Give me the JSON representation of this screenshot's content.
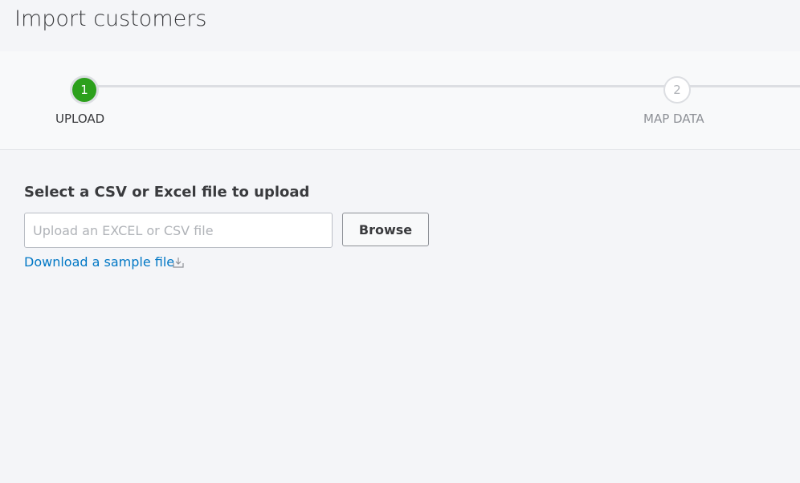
{
  "page": {
    "title": "Import customers"
  },
  "steps": [
    {
      "number": "1",
      "label": "UPLOAD",
      "state": "active"
    },
    {
      "number": "2",
      "label": "MAP DATA",
      "state": "inactive"
    }
  ],
  "upload": {
    "heading": "Select a CSV or Excel file to upload",
    "placeholder": "Upload an EXCEL or CSV file",
    "browse_label": "Browse",
    "download_link": "Download a sample file",
    "download_icon": "download-icon"
  },
  "colors": {
    "accent": "#2ca01c",
    "link": "#0077c5"
  }
}
